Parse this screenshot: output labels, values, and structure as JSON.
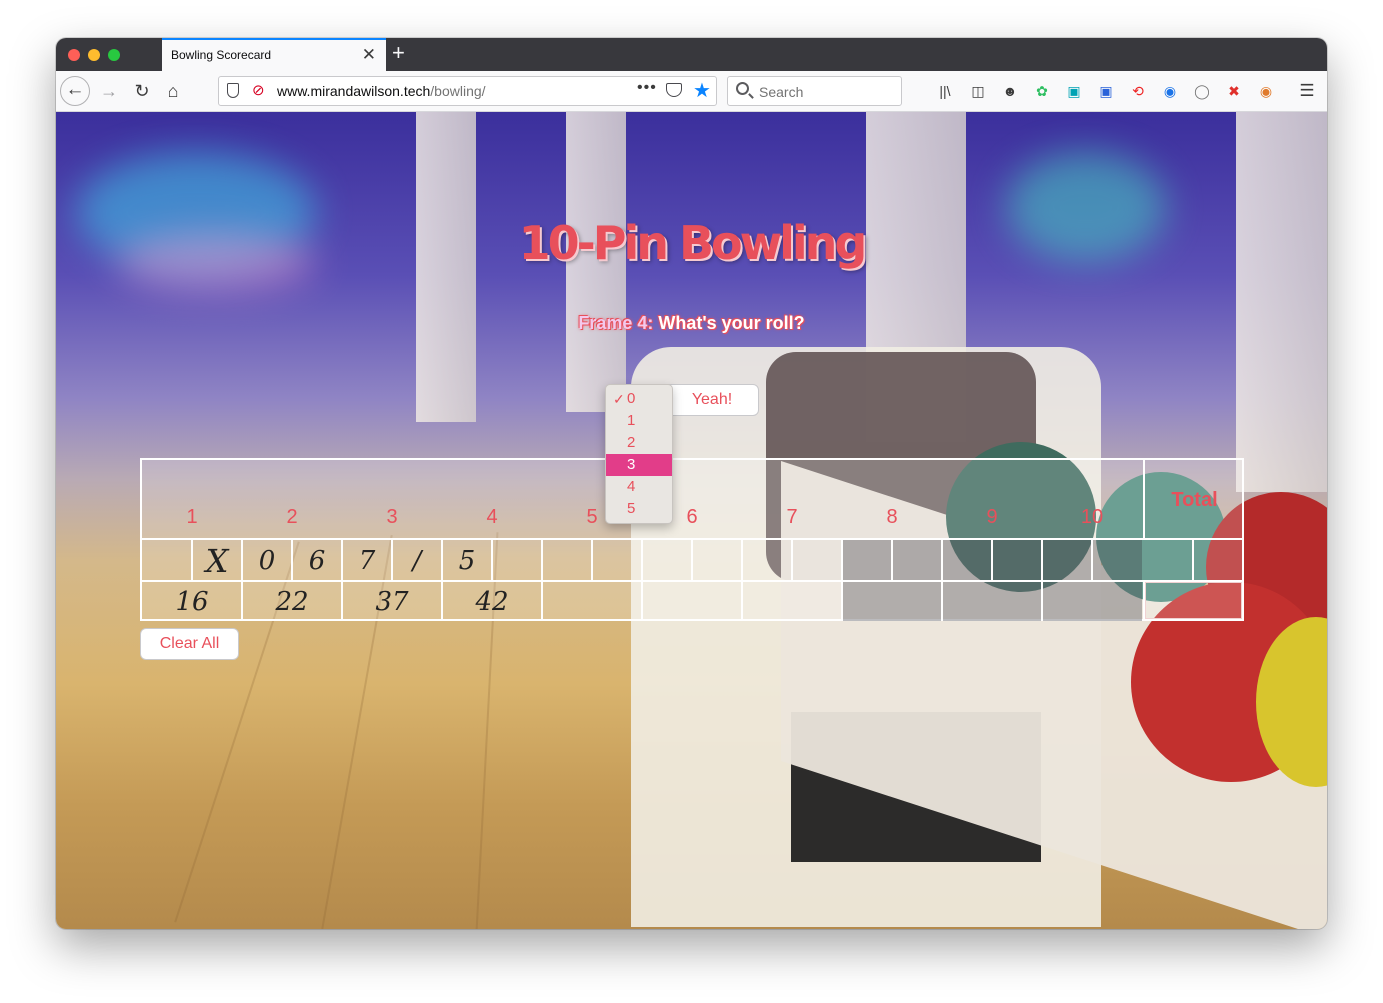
{
  "browser": {
    "tab_title": "Bowling Scorecard",
    "tab_close": "✕",
    "new_tab": "+",
    "url_domain": "www.mirandawilson.tech",
    "url_path": "/bowling/",
    "page_actions": "•••",
    "search_placeholder": "Search",
    "accent_color": "#0a84ff"
  },
  "page": {
    "title": "10-Pin Bowling",
    "prompt_frame": "Frame 4:",
    "prompt_question": "What's your roll?",
    "submit_label": "Yeah!",
    "clear_label": "Clear All",
    "accent_color": "#e8505b"
  },
  "roll_select": {
    "options": [
      "0",
      "1",
      "2",
      "3",
      "4",
      "5"
    ],
    "checked": "0",
    "highlighted": "3"
  },
  "scorecard": {
    "frames": [
      "1",
      "2",
      "3",
      "4",
      "5",
      "6",
      "7",
      "8",
      "9",
      "10"
    ],
    "total_label": "Total",
    "rolls": [
      [
        "",
        "X"
      ],
      [
        "0",
        "6"
      ],
      [
        "7",
        "/"
      ],
      [
        "5",
        ""
      ]
    ],
    "cumulative": [
      "16",
      "22",
      "37",
      "42"
    ]
  }
}
